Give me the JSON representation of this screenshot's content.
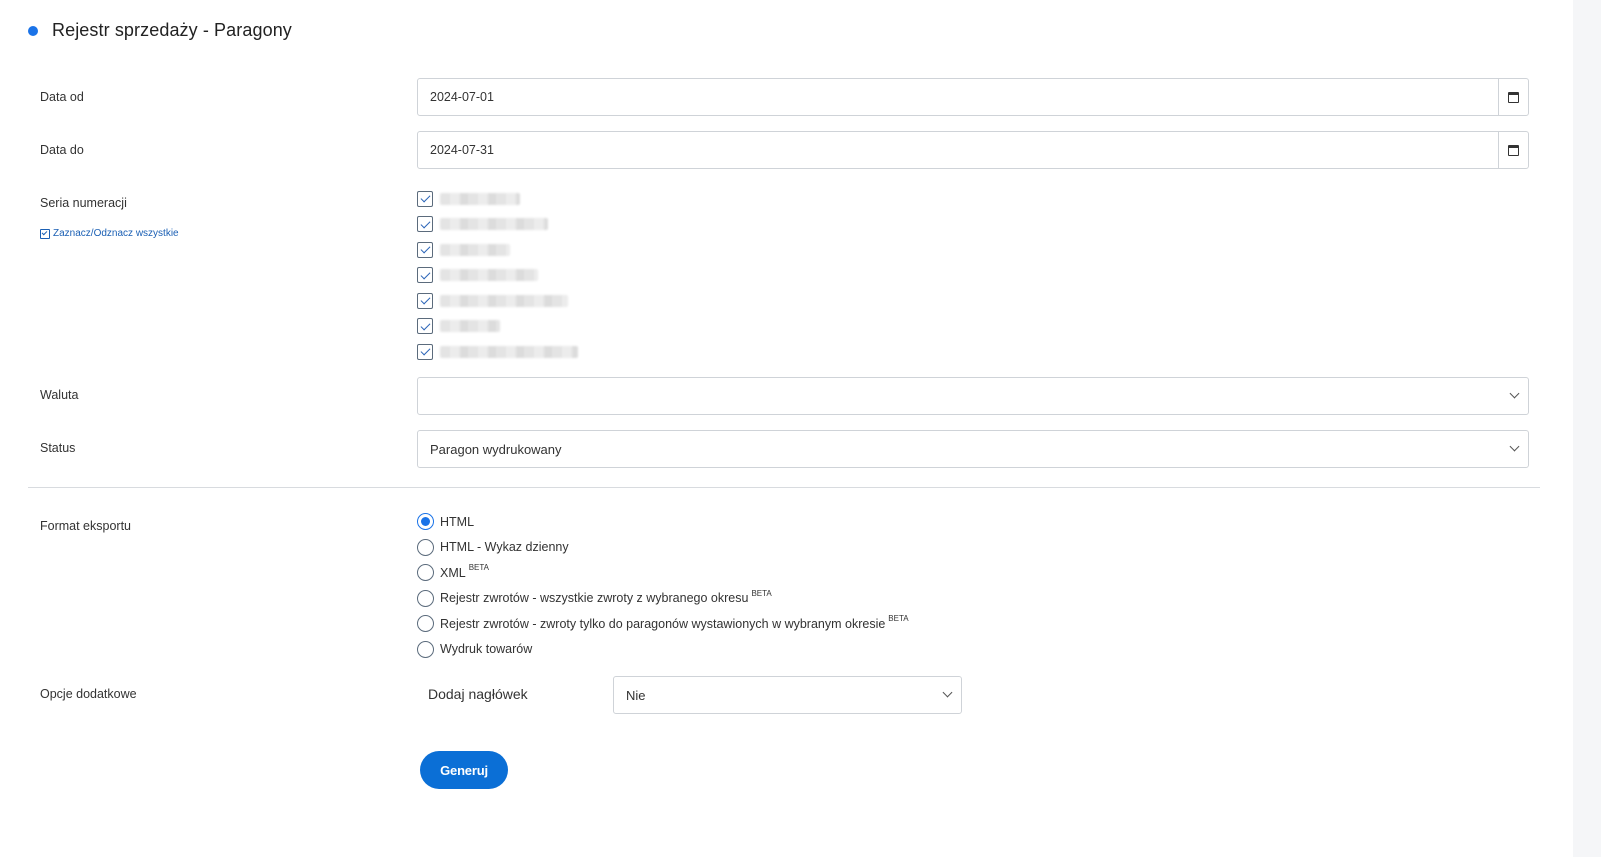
{
  "page": {
    "title": "Rejestr sprzedaży - Paragony"
  },
  "form": {
    "date_from": {
      "label": "Data od",
      "value": "2024-07-01"
    },
    "date_to": {
      "label": "Data do",
      "value": "2024-07-31"
    },
    "series": {
      "label": "Seria numeracji",
      "toggle_all": "Zaznacz/Odznacz wszystkie",
      "items": [
        {
          "checked": true,
          "redacted_width": 80
        },
        {
          "checked": true,
          "redacted_width": 108
        },
        {
          "checked": true,
          "redacted_width": 70
        },
        {
          "checked": true,
          "redacted_width": 98
        },
        {
          "checked": true,
          "redacted_width": 128
        },
        {
          "checked": true,
          "redacted_width": 60
        },
        {
          "checked": true,
          "redacted_width": 138
        }
      ]
    },
    "currency": {
      "label": "Waluta",
      "value": ""
    },
    "status": {
      "label": "Status",
      "value": "Paragon wydrukowany"
    },
    "export_format": {
      "label": "Format eksportu",
      "options": [
        {
          "label": "HTML",
          "sup": "",
          "checked": true
        },
        {
          "label": "HTML - Wykaz dzienny",
          "sup": "",
          "checked": false
        },
        {
          "label": "XML",
          "sup": "BETA",
          "checked": false
        },
        {
          "label": "Rejestr zwrotów - wszystkie zwroty z wybranego okresu",
          "sup": "BETA",
          "checked": false
        },
        {
          "label": "Rejestr zwrotów - zwroty tylko do paragonów wystawionych w wybranym okresie",
          "sup": "BETA",
          "checked": false
        },
        {
          "label": "Wydruk towarów",
          "sup": "",
          "checked": false
        }
      ]
    },
    "extra_options": {
      "label": "Opcje dodatkowe",
      "add_header_label": "Dodaj nagłówek",
      "add_header_value": "Nie"
    },
    "generate_button": "Generuj"
  },
  "colors": {
    "accent": "#0b6fd6",
    "dot": "#1a73e8"
  }
}
